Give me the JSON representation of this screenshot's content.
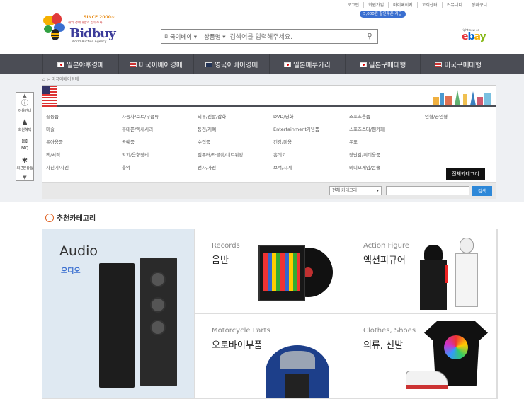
{
  "top_links": [
    "로그인",
    "회원가입",
    "마이페이지",
    "고객센터",
    "커뮤니티",
    "장바구니"
  ],
  "coupon": "5,000원 할인쿠폰 지급",
  "logo": {
    "since": "SINCE 2000~",
    "tagline": "해외 경매대행의 선두주자!",
    "brand": "Bidbuy",
    "sub": "World Auction Agency"
  },
  "search": {
    "market": "미국이베이",
    "type": "상품명",
    "placeholder": "검색어를 입력해주세요."
  },
  "ebay": {
    "small": "right now on",
    "logo": "ebay"
  },
  "nav": [
    {
      "label": "일본야후경매",
      "flag": "jp"
    },
    {
      "label": "미국이베이경매",
      "flag": "us"
    },
    {
      "label": "영국이베이경매",
      "flag": "uk"
    },
    {
      "label": "일본메루카리",
      "flag": "jp"
    },
    {
      "label": "일본구매대행",
      "flag": "jp"
    },
    {
      "label": "미국구매대행",
      "flag": "us"
    }
  ],
  "breadcrumb": "미국이베이경매",
  "side": [
    {
      "label": "이용안내",
      "icon": "info-icon"
    },
    {
      "label": "회원혜택",
      "icon": "member-icon"
    },
    {
      "label": "FAQ",
      "icon": "faq-icon"
    },
    {
      "label": "최근본상품",
      "icon": "star-icon"
    }
  ],
  "categories": [
    "골동품",
    "자동차/보트/부품류",
    "의류/신발/잡화",
    "DVD/영화",
    "스포츠용품",
    "인형/공인형",
    "미술",
    "휴대폰/액세서리",
    "동전/지폐",
    "Entertainment기념품",
    "스포츠스타/팬카페",
    "",
    "유아용품",
    "공예품",
    "수집품",
    "건강/미용",
    "우표",
    "",
    "책/서적",
    "악기/음향장비",
    "컴퓨터/타블렛/네트워킹",
    "홈데코",
    "장난감/취미용품",
    "",
    "사진기/사진",
    "음악",
    "전자/가전",
    "보석/시계",
    "비디오게임/콘솔",
    ""
  ],
  "all_categories": "전체카테고리",
  "cat_select": "전체 카테고리",
  "cat_search_btn": "검색",
  "rec_title": "추천카테고리",
  "tiles": [
    {
      "en": "Audio",
      "ko": "오디오"
    },
    {
      "en": "Records",
      "ko": "음반"
    },
    {
      "en": "Action Figure",
      "ko": "액션피규어"
    },
    {
      "en": "Motorcycle Parts",
      "ko": "오토바이부품"
    },
    {
      "en": "Clothes, Shoes",
      "ko": "의류, 신발"
    }
  ]
}
